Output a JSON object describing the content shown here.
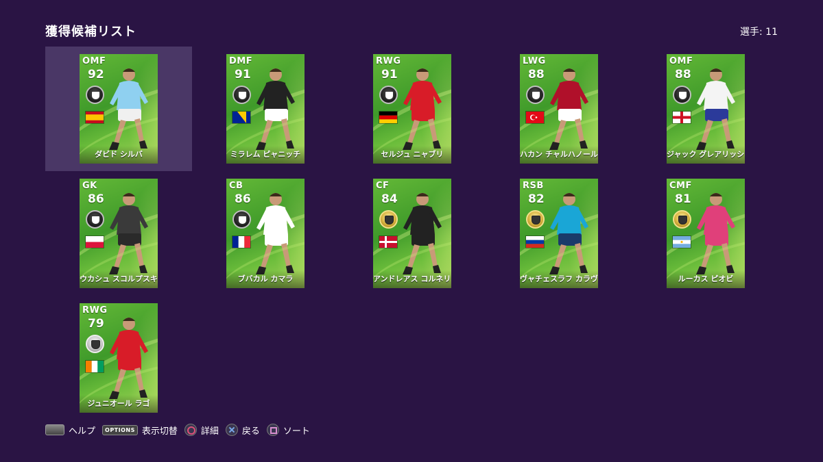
{
  "header": {
    "title": "獲得候補リスト",
    "count": "選手: 11"
  },
  "players": [
    {
      "position": "OMF",
      "rating": "92",
      "name": "ダビド シルバ",
      "badge": "black",
      "flag": "spain",
      "kit": "#8fd0f0",
      "shorts": "#f0f0f0",
      "selected": true
    },
    {
      "position": "DMF",
      "rating": "91",
      "name": "ミラレム ピャニッチ",
      "badge": "black",
      "flag": "bosnia",
      "kit": "#222222",
      "shorts": "#ffffff",
      "selected": false
    },
    {
      "position": "RWG",
      "rating": "91",
      "name": "セルジュ ニャブリ",
      "badge": "black",
      "flag": "germany",
      "kit": "#d81c28",
      "shorts": "#d81c28",
      "selected": false
    },
    {
      "position": "LWG",
      "rating": "88",
      "name": "ハカン チャルハノール",
      "badge": "black",
      "flag": "turkey",
      "kit": "#b0102a",
      "shorts": "#ffffff",
      "selected": false
    },
    {
      "position": "OMF",
      "rating": "88",
      "name": "ジャック グレアリッシュ",
      "badge": "black",
      "flag": "england",
      "kit": "#f4f4f4",
      "shorts": "#2b3a9a",
      "selected": false
    },
    {
      "position": "GK",
      "rating": "86",
      "name": "ウカシュ スコルプスキ",
      "badge": "black",
      "flag": "poland",
      "kit": "#3a3a3a",
      "shorts": "#2a2a2a",
      "selected": false
    },
    {
      "position": "CB",
      "rating": "86",
      "name": "ブバカル カマラ",
      "badge": "black",
      "flag": "france",
      "kit": "#ffffff",
      "shorts": "#ffffff",
      "selected": false
    },
    {
      "position": "CF",
      "rating": "84",
      "name": "アンドレアス コルネリウス",
      "badge": "gold",
      "flag": "denmark",
      "kit": "#222222",
      "shorts": "#222222",
      "selected": false
    },
    {
      "position": "RSB",
      "rating": "82",
      "name": "ヴャチェスラフ カラヴァエフ",
      "badge": "gold",
      "flag": "russia",
      "kit": "#1aa6d6",
      "shorts": "#1a3a6a",
      "selected": false
    },
    {
      "position": "CMF",
      "rating": "81",
      "name": "ルーカス ピオビ",
      "badge": "gold",
      "flag": "argentina",
      "kit": "#e0407a",
      "shorts": "#e0407a",
      "selected": false
    },
    {
      "position": "RWG",
      "rating": "79",
      "name": "ジュニオール ラゴ",
      "badge": "silver",
      "flag": "ivorycoast",
      "kit": "#d81c28",
      "shorts": "#d81c28",
      "selected": false
    }
  ],
  "footer": {
    "help": "ヘルプ",
    "options_key": "OPTIONS",
    "toggle_view": "表示切替",
    "details": "詳細",
    "back": "戻る",
    "sort": "ソート"
  }
}
